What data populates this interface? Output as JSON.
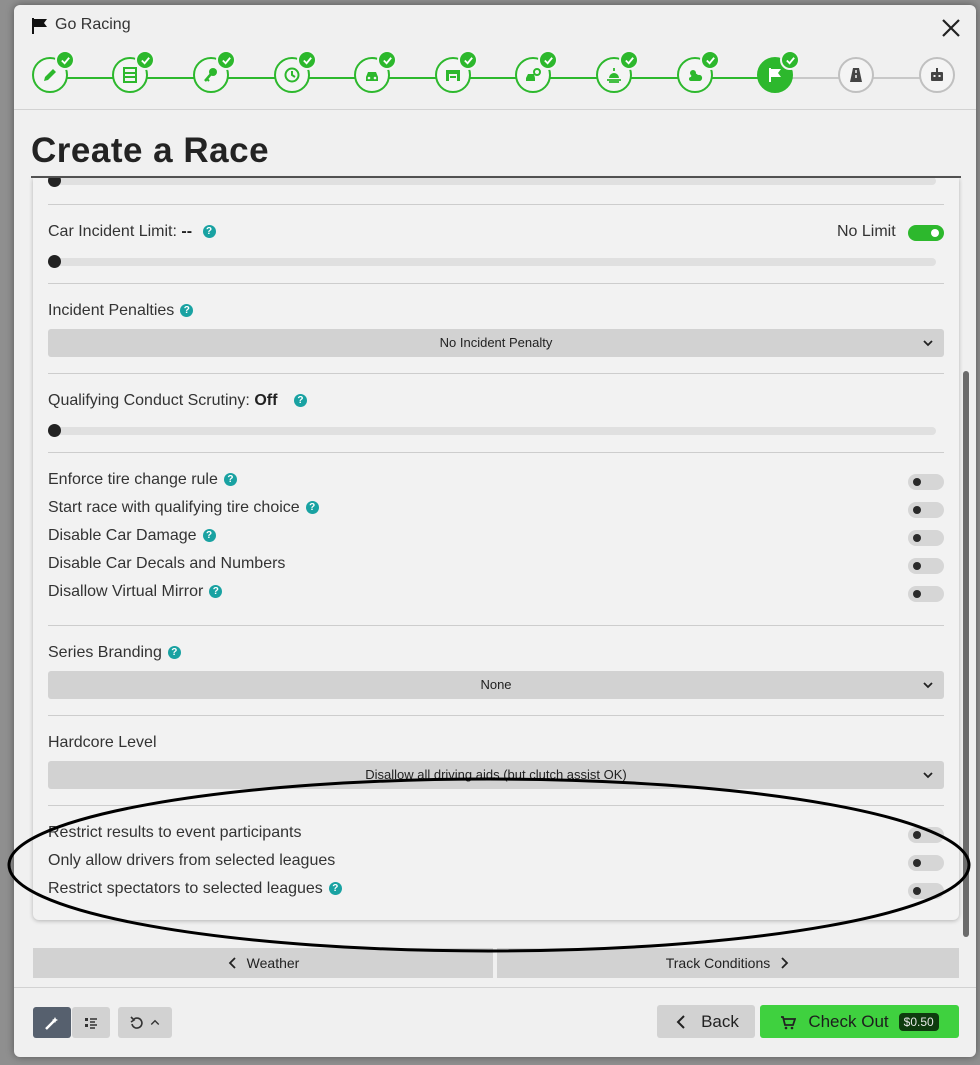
{
  "window": {
    "title": "Go Racing"
  },
  "steps": [
    {
      "icon": "pencil-icon",
      "done": true
    },
    {
      "icon": "list-icon",
      "done": true
    },
    {
      "icon": "key-icon",
      "done": true
    },
    {
      "icon": "clock-icon",
      "done": true
    },
    {
      "icon": "car-icon",
      "done": true
    },
    {
      "icon": "garage-icon",
      "done": true
    },
    {
      "icon": "car-settings-icon",
      "done": true
    },
    {
      "icon": "sunrise-icon",
      "done": true
    },
    {
      "icon": "weather-icon",
      "done": true
    },
    {
      "icon": "flag-icon",
      "done": true,
      "active": true
    },
    {
      "icon": "road-icon",
      "done": false
    },
    {
      "icon": "robot-icon",
      "done": false
    }
  ],
  "page": {
    "heading": "Create a Race"
  },
  "settings": {
    "car_incident_limit": {
      "label": "Car Incident Limit:",
      "value": "--",
      "no_limit_label": "No Limit",
      "no_limit_on": true,
      "slider_fraction": 0
    },
    "incident_penalties": {
      "label": "Incident Penalties",
      "selected": "No Incident Penalty"
    },
    "qualifying_scrutiny": {
      "label": "Qualifying Conduct Scrutiny:",
      "value": "Off",
      "slider_fraction": 0
    },
    "toggles": [
      {
        "label": "Enforce tire change rule",
        "help": true,
        "on": false
      },
      {
        "label": "Start race with qualifying tire choice",
        "help": true,
        "on": false
      },
      {
        "label": "Disable Car Damage",
        "help": true,
        "on": false
      },
      {
        "label": "Disable Car Decals and Numbers",
        "help": false,
        "on": false
      },
      {
        "label": "Disallow Virtual Mirror",
        "help": true,
        "on": false
      }
    ],
    "series_branding": {
      "label": "Series Branding",
      "selected": "None"
    },
    "hardcore_level": {
      "label": "Hardcore Level",
      "selected": "Disallow all driving aids (but clutch assist OK)"
    },
    "league_toggles": [
      {
        "label": "Restrict results to event participants",
        "help": false,
        "on": false
      },
      {
        "label": "Only allow drivers from selected leagues",
        "help": false,
        "on": false
      },
      {
        "label": "Restrict spectators to selected leagues",
        "help": true,
        "on": false
      }
    ]
  },
  "nav": {
    "prev_label": "Weather",
    "next_label": "Track Conditions"
  },
  "footer": {
    "back_label": "Back",
    "checkout_label": "Check Out",
    "price": "$0.50"
  },
  "colors": {
    "accent": "#2db82d",
    "checkout": "#3fd13f",
    "help": "#19a2a2"
  }
}
